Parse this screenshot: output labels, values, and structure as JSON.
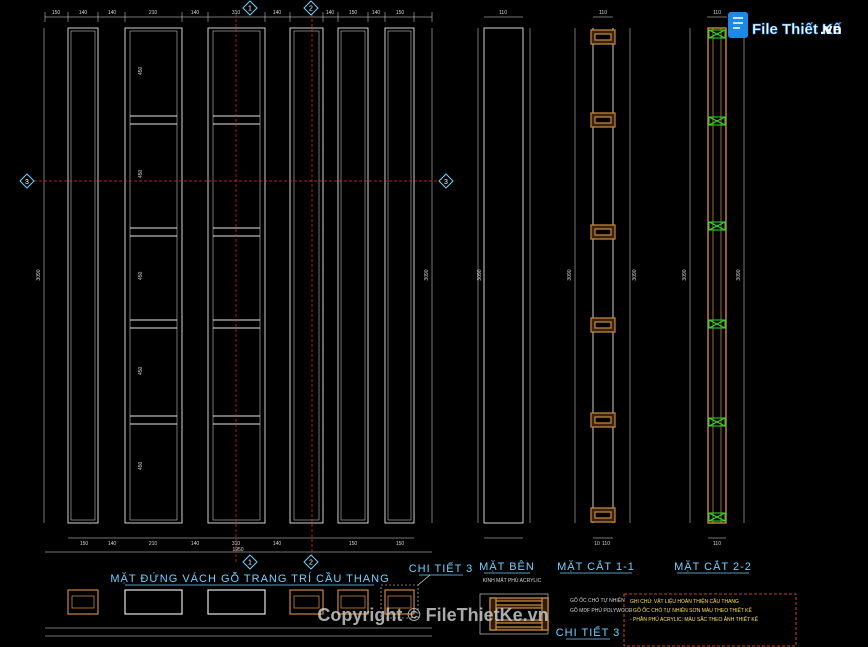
{
  "drawing_titles": {
    "front_elevation": "MẶT ĐỨNG VÁCH GỖ TRANG TRÍ CẦU THANG",
    "side_view": "MẶT BÊN",
    "section_1": "MẶT CẮT 1-1",
    "section_2": "MẶT CẮT 2-2",
    "detail_3_top": "CHI TIẾT 3",
    "detail_3_bottom": "CHI TIẾT 3"
  },
  "grid_markers": {
    "marker_1": "1",
    "marker_2": "2",
    "marker_3": "3"
  },
  "dimensions": {
    "top_widths": [
      "150",
      "140",
      "210",
      "140",
      "310",
      "140",
      "210",
      "140",
      "150",
      "150"
    ],
    "total_height": "3090",
    "total_width": "1950",
    "bay_heights": [
      "450",
      "450",
      "450",
      "450",
      "450",
      "450"
    ],
    "side_width": "110",
    "section_bottom": [
      "10",
      "110",
      "10"
    ]
  },
  "detail_labels": {
    "glass_label": "KÍNH MẶT PHỦ ACRYLIC",
    "line_1": "GỖ ỐC CHÓ TỰ NHIÊN",
    "line_2": "GỖ MDF PHỦ POLYWOOD"
  },
  "notes": {
    "heading": "GHI CHÚ: VẬT LIỆU HOÀN THIỆN CẦU THANG",
    "line_1": "- GỖ ỐC CHÓ TỰ NHIÊN SƠN MÀU THEO THIẾT KẾ",
    "line_2": "- PHẦN PHỦ ACRYLIC: MÀU SẮC THEO ẢNH THIẾT KẾ"
  },
  "watermark": "Copyright © FileThietKe.vn",
  "logo": {
    "text": "File Thiết Kế",
    "suffix": ".vn"
  },
  "colors": {
    "background": "#000000",
    "line_white": "#e6e6e6",
    "wood": "#c8883e",
    "red_grid": "#ff2020",
    "cyan_title": "#6fd2ff",
    "green_block": "#2ee02e",
    "logo_blue": "#1e88e5"
  }
}
